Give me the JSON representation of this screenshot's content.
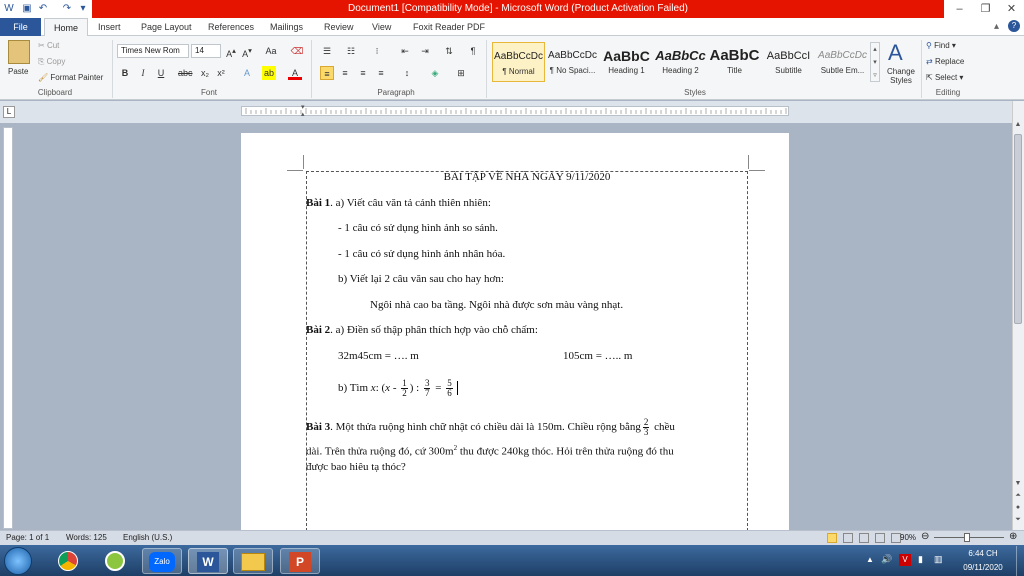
{
  "window": {
    "title": "Document1 [Compatibility Mode]  -  Microsoft Word (Product Activation Failed)"
  },
  "tabs": [
    "File",
    "Home",
    "Insert",
    "Page Layout",
    "References",
    "Mailings",
    "Review",
    "View",
    "Foxit Reader PDF"
  ],
  "clipboard": {
    "paste": "Paste",
    "cut": "Cut",
    "copy": "Copy",
    "format_painter": "Format Painter",
    "group": "Clipboard"
  },
  "font": {
    "name": "Times New Rom",
    "size": "14",
    "group": "Font"
  },
  "paragraph": {
    "group": "Paragraph"
  },
  "styles": {
    "items": [
      {
        "sample": "AaBbCcDc",
        "name": "¶ Normal"
      },
      {
        "sample": "AaBbCcDc",
        "name": "¶ No Spaci..."
      },
      {
        "sample": "AaBbC",
        "name": "Heading 1"
      },
      {
        "sample": "AaBbCc",
        "name": "Heading 2"
      },
      {
        "sample": "AaBbC",
        "name": "Title"
      },
      {
        "sample": "AaBbCcI",
        "name": "Subtitle"
      },
      {
        "sample": "AaBbCcDc",
        "name": "Subtle Em..."
      }
    ],
    "change_styles": "Change Styles",
    "group": "Styles"
  },
  "editing": {
    "find": "Find",
    "replace": "Replace",
    "select": "Select",
    "group": "Editing"
  },
  "document": {
    "title": "BÀI TẬP VỀ NHÀ NGÀY 9/11/2020",
    "bai1_label": "Bài 1",
    "bai1_a": ". a) Viết câu văn tả cảnh thiên  nhiên:",
    "bai1_a1": "- 1 câu có sử dụng hình ảnh so sánh.",
    "bai1_a2": "- 1 câu có sử dụng hình ảnh nhân hóa.",
    "bai1_b": "b) Viết lại 2 câu văn sau cho hay hơn:",
    "bai1_b_text": "Ngôi nhà cao ba tầng. Ngôi nhà được sơn màu vàng  nhạt.",
    "bai2_label": "Bài 2",
    "bai2_a": ". a) Điền số thập phân thích hợp vào chỗ chấm:",
    "bai2_q1": "32m45cm = …. m",
    "bai2_q2": "105cm = ….. m",
    "bai2_b_prefix": "b) Tìm ",
    "bai2_b_x": "x",
    "bai2_b_mid1": ": (",
    "bai2_b_mid2": " - ",
    "bai2_b_close": ") : ",
    "bai2_b_eq": " = ",
    "frac1": {
      "num": "1",
      "den": "2"
    },
    "frac2": {
      "num": "3",
      "den": "7"
    },
    "frac3": {
      "num": "5",
      "den": "6"
    },
    "bai3_label": "Bài 3",
    "bai3_line1": ". Một thửa ruộng hình chữ nhật có chiều dài là 150m. Chiều rộng bằng",
    "frac4": {
      "num": "2",
      "den": "3"
    },
    "bai3_line1_end": " chều",
    "bai3_line2a": "dài. Trên thửa ruộng đó, cứ 300m",
    "bai3_sup": "2",
    "bai3_line2b": " thu được 240kg thóc. Hỏi trên thửa ruộng đó thu",
    "bai3_line3": "được bao hiêu tạ thóc?"
  },
  "status": {
    "page": "Page: 1 of 1",
    "words": "Words: 125",
    "language": "English (U.S.)",
    "zoom": "90%"
  },
  "taskbar": {
    "time": "6:44 CH",
    "date": "09/11/2020",
    "zalo": "Zalo"
  },
  "colors": {
    "title_red": "#e51400",
    "file_blue": "#2b579a"
  }
}
